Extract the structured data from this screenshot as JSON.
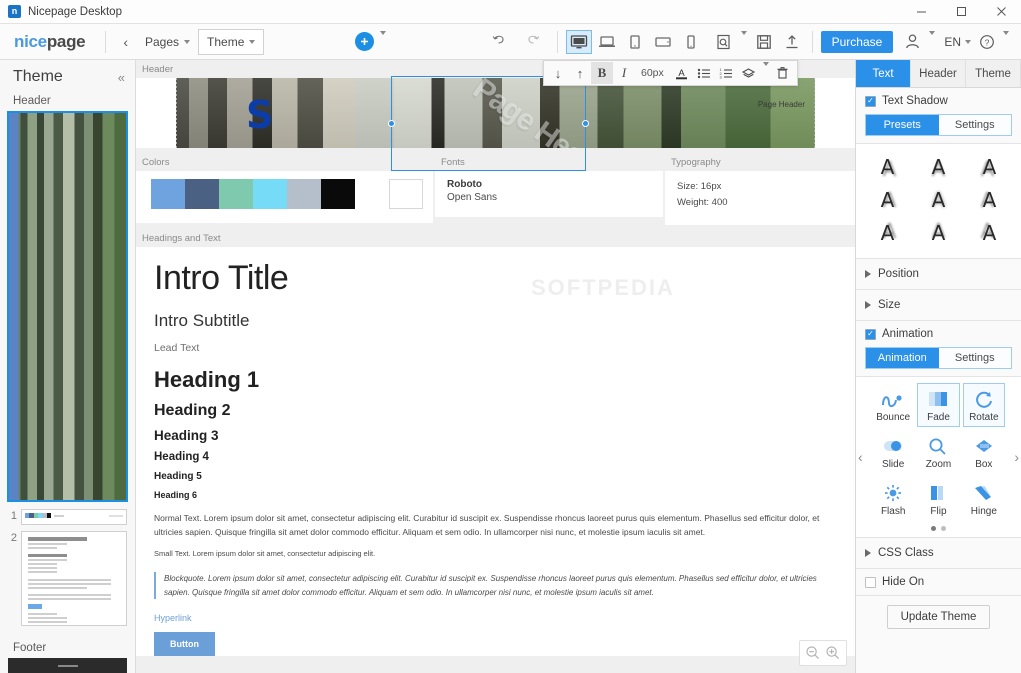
{
  "window": {
    "title": "Nicepage Desktop",
    "logo_letter": "n",
    "minimize": "–",
    "maximize": "☐",
    "close": "✕"
  },
  "toolbar": {
    "brand_first": "nice",
    "brand_second": "page",
    "back_label": "‹",
    "pages_label": "Pages",
    "theme_label": "Theme",
    "add_label": "+",
    "undo_label": "↶",
    "redo_label": "↷",
    "devices": [
      {
        "name": "desktop",
        "glyph": "Ὓ5",
        "active": true
      },
      {
        "name": "laptop",
        "glyph": "",
        "active": false
      },
      {
        "name": "tablet-portrait",
        "glyph": "",
        "active": false
      },
      {
        "name": "tablet-landscape",
        "glyph": "",
        "active": false
      },
      {
        "name": "phone",
        "glyph": "",
        "active": false
      }
    ],
    "preview_label": "preview",
    "save_label": "save",
    "publish_label": "publish",
    "purchase_label": "Purchase",
    "account_label": "account",
    "language_label": "EN",
    "help_label": "?"
  },
  "left_panel": {
    "title": "Theme",
    "collapse_label": "«",
    "header_label": "Header",
    "footer_label": "Footer",
    "page_numbers": [
      "1",
      "2"
    ]
  },
  "float_toolbar": {
    "move_down": "↓",
    "move_up": "↑",
    "bold": "B",
    "italic": "I",
    "font_size": "60px",
    "text_color": "A",
    "bullet_list": "☰",
    "numbered_list": "☷",
    "effects": "◈",
    "delete": "Ὕ1"
  },
  "canvas": {
    "header_section_label": "Header",
    "header_logo": "S",
    "header_rotated_text": "Page Header",
    "header_right_text": "Page Header",
    "watermark": "SOFTPEDIA",
    "colors_label": "Colors",
    "color_swatches": [
      "#6ea3df",
      "#4a6184",
      "#7fc9ae",
      "#76dbf7",
      "#b4bfcb",
      "#0a0a0a",
      "#ffffff",
      "#ffffff"
    ],
    "fonts_label": "Fonts",
    "font_primary": "Roboto",
    "font_secondary": "Open Sans",
    "typography_label": "Typography",
    "typography_size": "Size: 16px",
    "typography_weight": "Weight: 400",
    "headings_label": "Headings and Text",
    "intro_title": "Intro Title",
    "intro_subtitle": "Intro Subtitle",
    "lead_text": "Lead Text",
    "heading1": "Heading 1",
    "heading2": "Heading 2",
    "heading3": "Heading 3",
    "heading4": "Heading 4",
    "heading5": "Heading 5",
    "heading6": "Heading 6",
    "normal_text": "Normal Text. Lorem ipsum dolor sit amet, consectetur adipiscing elit. Curabitur id suscipit ex. Suspendisse rhoncus laoreet purus quis elementum. Phasellus sed efficitur dolor, et ultricies sapien. Quisque fringilla sit amet dolor commodo efficitur. Aliquam et sem odio. In ullamcorper nisi nunc, et molestie ipsum iaculis sit amet.",
    "small_text": "Small Text. Lorem ipsum dolor sit amet, consectetur adipiscing elit.",
    "blockquote": "Blockquote. Lorem ipsum dolor sit amet, consectetur adipiscing elit. Curabitur id suscipit ex. Suspendisse rhoncus laoreet purus quis elementum. Phasellus sed efficitur dolor, et ultricies sapien. Quisque fringilla sit amet dolor commodo efficitur. Aliquam et sem odio. In ullamcorper nisi nunc, et molestie ipsum iaculis sit amet.",
    "hyperlink": "Hyperlink",
    "button": "Button",
    "zoom_out": "−",
    "zoom_in": "+"
  },
  "right_panel": {
    "tabs": [
      {
        "label": "Text",
        "active": true
      },
      {
        "label": "Header",
        "active": false
      },
      {
        "label": "Theme",
        "active": false
      }
    ],
    "text_shadow_label": "Text Shadow",
    "text_shadow_checked": true,
    "shadow_presets_label": "Presets",
    "shadow_settings_label": "Settings",
    "shadow_glyph": "A",
    "position_label": "Position",
    "size_label": "Size",
    "animation_label": "Animation",
    "animation_checked": true,
    "animation_tab_label": "Animation",
    "animation_settings_label": "Settings",
    "animations": [
      {
        "label": "Bounce",
        "selected": false
      },
      {
        "label": "Fade",
        "selected": true
      },
      {
        "label": "Rotate",
        "selected": true
      },
      {
        "label": "Slide",
        "selected": false
      },
      {
        "label": "Zoom",
        "selected": false
      },
      {
        "label": "Box",
        "selected": false
      },
      {
        "label": "Flash",
        "selected": false
      },
      {
        "label": "Flip",
        "selected": false
      },
      {
        "label": "Hinge",
        "selected": false
      }
    ],
    "prev_label": "‹",
    "next_label": "›",
    "css_class_label": "CSS Class",
    "hide_on_label": "Hide On",
    "hide_on_checked": false,
    "update_theme_label": "Update Theme"
  },
  "colors": {
    "accent": "#2b90e8",
    "purchase": "#2b8fe8",
    "selection": "#2f8fe6"
  }
}
